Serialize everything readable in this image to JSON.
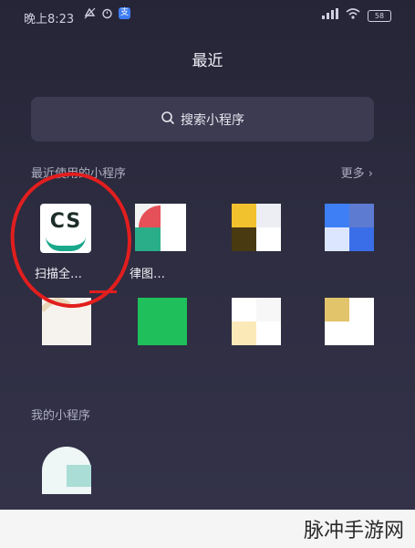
{
  "status_bar": {
    "time": "晚上8:23",
    "icons": [
      "silent-icon",
      "alarm-icon",
      "app-notification-icon"
    ],
    "battery": "58"
  },
  "header": {
    "title": "最近"
  },
  "search": {
    "label": "搜索小程序"
  },
  "recent": {
    "label": "最近使用的小程序",
    "more": "更多 ›",
    "apps": [
      {
        "name": "扫描全…",
        "icon_text": "CS"
      },
      {
        "name": "律图…"
      },
      {
        "name": ""
      },
      {
        "name": ""
      },
      {
        "name": ""
      },
      {
        "name": ""
      },
      {
        "name": ""
      },
      {
        "name": ""
      }
    ]
  },
  "mine": {
    "label": "我的小程序"
  },
  "watermark": "脉冲手游网",
  "colors": {
    "annotation_circle": "#e21e1e",
    "cs_green": "#19a98a"
  }
}
